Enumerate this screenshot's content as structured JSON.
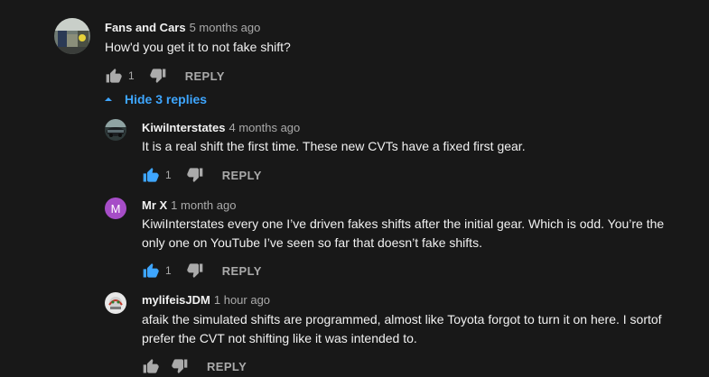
{
  "comments": [
    {
      "author": "Fans and Cars",
      "time": "5 months ago",
      "text": "How'd you get it to not fake shift?",
      "likes": "1",
      "reply_label": "REPLY"
    }
  ],
  "replies_toggle": {
    "label": "Hide 3 replies",
    "icon": "caret-up-icon"
  },
  "replies": [
    {
      "author": "KiwiInterstates",
      "time": "4 months ago",
      "text": "It is a real shift the first time. These new CVTs have a fixed first gear.",
      "likes": "1",
      "liked": true,
      "reply_label": "REPLY"
    },
    {
      "author": "Mr X",
      "avatar_letter": "M",
      "avatar_color": "#a64dc7",
      "time": "1 month ago",
      "text_line1": "KiwiInterstates every one I’ve driven fakes shifts after the initial gear. Which is odd. You’re the",
      "text_line2": "only one on YouTube I’ve seen so far that doesn’t fake shifts.",
      "likes": "1",
      "liked": true,
      "reply_label": "REPLY"
    },
    {
      "author": "mylifeisJDM",
      "time": "1 hour ago",
      "text_line1": "afaik the simulated shifts are programmed, almost like Toyota forgot to turn it on here. I sortof",
      "text_line2": "prefer the CVT not shifting like it was intended to.",
      "reply_label": "REPLY"
    }
  ],
  "colors": {
    "background": "#181818",
    "link_blue": "#3ea6ff",
    "liked_blue": "#3ea6ff",
    "muted": "#aaaaaa"
  }
}
